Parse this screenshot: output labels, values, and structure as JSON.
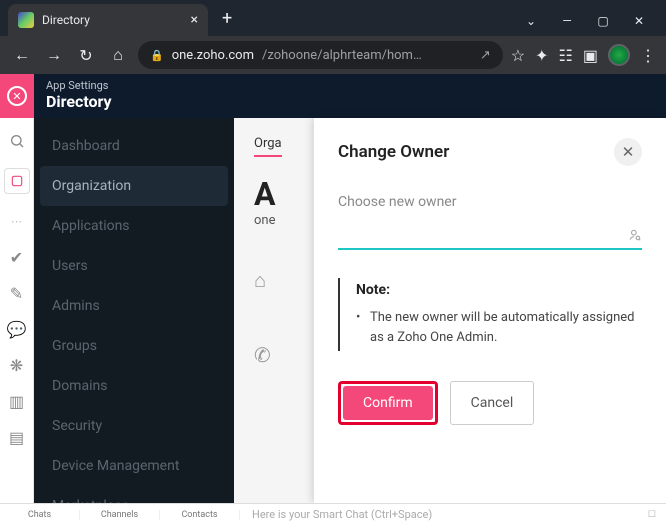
{
  "browser": {
    "tab_title": "Directory",
    "url_host": "one.zoho.com",
    "url_path": "/zohoone/alphrteam/hom…"
  },
  "header": {
    "breadcrumb": "App Settings",
    "title": "Directory"
  },
  "sidebar": {
    "items": [
      "Dashboard",
      "Organization",
      "Applications",
      "Users",
      "Admins",
      "Groups",
      "Domains",
      "Security",
      "Device Management",
      "Marketplace"
    ]
  },
  "content": {
    "tab": "Orga",
    "heading_fragment": "A",
    "sub_fragment": "one"
  },
  "modal": {
    "title": "Change Owner",
    "field_label": "Choose new owner",
    "input_value": "",
    "note_title": "Note:",
    "note_body": "The new owner will be automatically assigned as a Zoho One Admin.",
    "confirm": "Confirm",
    "cancel": "Cancel"
  },
  "bottombar": {
    "chats": "Chats",
    "channels": "Channels",
    "contacts": "Contacts",
    "placeholder": "Here is your Smart Chat (Ctrl+Space)"
  }
}
